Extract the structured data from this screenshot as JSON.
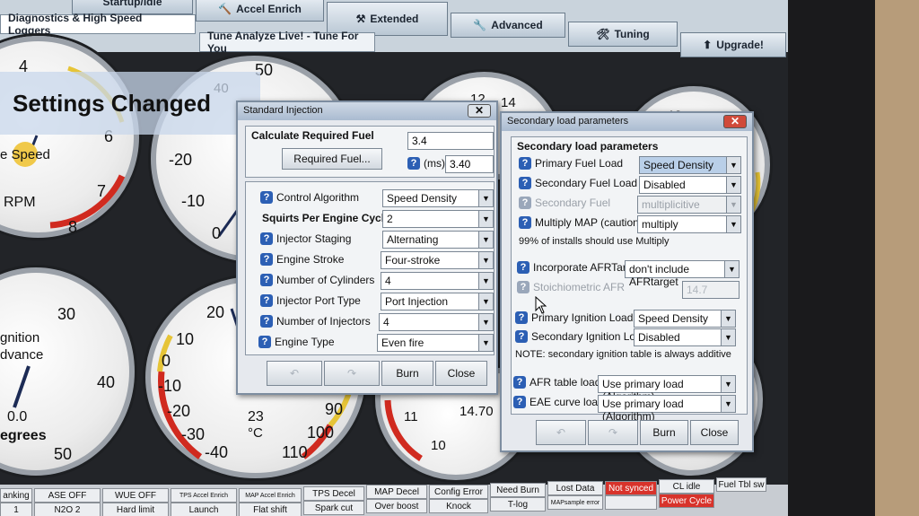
{
  "top_tabs": {
    "partial": "Startup/Idle",
    "accel": "Accel Enrich",
    "extended": "Extended",
    "advanced": "Advanced",
    "tuning": "Tuning",
    "upgrade": "Upgrade!"
  },
  "sub_tabs": [
    "Diagnostics & High Speed Loggers",
    "Tune Analyze Live! - Tune For You"
  ],
  "banner": "Settings Changed",
  "gauges": {
    "rpm": {
      "ticks": [
        "4",
        "6",
        "7",
        "8"
      ],
      "label": "RPM",
      "unit_frag": "e Speed"
    },
    "map": {
      "ticks": [
        "50",
        "40",
        "-20",
        "-10",
        "0"
      ]
    },
    "afr_top": {
      "ticks": [
        "12",
        "14"
      ]
    },
    "afr_right": {
      "ticks": [
        "12",
        "14"
      ]
    },
    "ign": {
      "ticks": [
        "30",
        "40",
        "50"
      ],
      "value": "0.0",
      "label1": "gnition",
      "label2": "dvance",
      "label3": "egrees"
    },
    "clt": {
      "ticks": [
        "20",
        "10",
        "0",
        "-10",
        "-20",
        "-30",
        "-40",
        "90",
        "100",
        "110"
      ],
      "value": "23",
      "unit": "°C"
    },
    "afr_bottom": {
      "ticks": [
        "11",
        "10"
      ],
      "value": "14.70"
    }
  },
  "std_injection": {
    "title": "Standard Injection",
    "group_title": "Calculate Required Fuel",
    "req_fuel_button": "Required Fuel...",
    "req_fuel_value": "3.4",
    "ms_label": "(ms)",
    "ms_value": "3.40",
    "fields": [
      {
        "label": "Control Algorithm",
        "value": "Speed Density",
        "help": true
      },
      {
        "label": "Squirts Per Engine Cycle",
        "value": "2",
        "help": false
      },
      {
        "label": "Injector Staging",
        "value": "Alternating",
        "help": true
      },
      {
        "label": "Engine Stroke",
        "value": "Four-stroke",
        "help": true
      },
      {
        "label": "Number of Cylinders",
        "value": "4",
        "help": true
      },
      {
        "label": "Injector Port Type",
        "value": "Port Injection",
        "help": true
      },
      {
        "label": "Number of Injectors",
        "value": "4",
        "help": true
      },
      {
        "label": "Engine Type",
        "value": "Even fire",
        "help": true
      }
    ],
    "burn": "Burn",
    "close": "Close"
  },
  "secondary_load": {
    "title": "Secondary load parameters",
    "group_title": "Secondary load parameters",
    "fields": [
      {
        "label": "Primary Fuel Load",
        "value": "Speed Density",
        "disabled": false
      },
      {
        "label": "Secondary Fuel Load",
        "value": "Disabled",
        "disabled": false
      },
      {
        "label": "Secondary Fuel",
        "value": "multiplicitive",
        "disabled": true
      },
      {
        "label": "Multiply MAP (caution!)",
        "value": "multiply",
        "disabled": false
      }
    ],
    "note1": "99% of installs should use Multiply",
    "afr_target_label": "Incorporate AFRTarget",
    "afr_target_value": "don't include AFRtarget",
    "stoich_label": "Stoichiometric AFR",
    "stoich_value": "14.7",
    "ign_fields": [
      {
        "label": "Primary Ignition Load",
        "value": "Speed Density"
      },
      {
        "label": "Secondary Ignition Load",
        "value": "Disabled"
      }
    ],
    "note2": "NOTE: secondary ignition table is always additive",
    "load_fields": [
      {
        "label": "AFR table load",
        "value": "Use primary load (Algorithm)"
      },
      {
        "label": "EAE curve load",
        "value": "Use primary load (Algorithm)"
      }
    ],
    "burn": "Burn",
    "close": "Close"
  },
  "status_bar": {
    "row1": [
      "anking",
      "ASE OFF",
      "WUE OFF",
      "TPS Accel Enrich",
      "MAP Accel Enrich",
      "TPS Decel",
      "MAP Decel",
      "Config Error",
      "Need Burn",
      "Lost Data",
      "Not synced",
      "CL idle",
      "Fuel Tbl sw"
    ],
    "row2": [
      "1",
      "N2O 2",
      "Hard limit",
      "Launch",
      "Flat shift",
      "Spark cut",
      "Over boost",
      "Knock",
      "T-log",
      "MAPsample error",
      "",
      "Power Cycle"
    ]
  },
  "colors": {
    "alert_red": "#d8332b",
    "help_blue": "#2c5fb4",
    "highlight": "#b9cfe8"
  }
}
